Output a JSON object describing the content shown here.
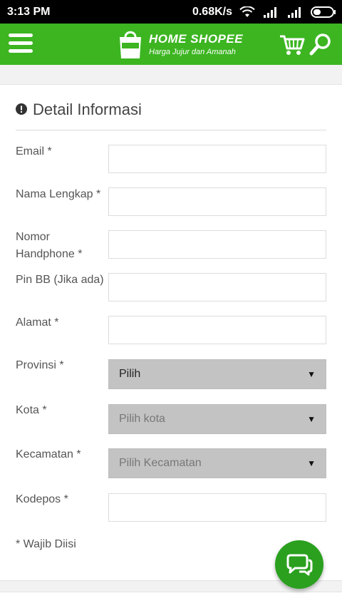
{
  "status_bar": {
    "time": "3:13 PM",
    "speed": "0.68K/s"
  },
  "header": {
    "brand": "HOME SHOPEE",
    "tagline": "Harga Jujur dan Amanah",
    "bag_text": "HOME"
  },
  "form": {
    "title": "Detail Informasi",
    "email_label": "Email *",
    "name_label": "Nama Lengkap *",
    "phone_label": "Nomor Handphone *",
    "pinbb_label": "Pin BB (Jika ada)",
    "address_label": "Alamat *",
    "province_label": "Provinsi *",
    "province_value": "Pilih",
    "city_label": "Kota *",
    "city_value": "Pilih kota",
    "district_label": "Kecamatan *",
    "district_value": "Pilih Kecamatan",
    "postcode_label": "Kodepos *",
    "required_note": "* Wajib Diisi"
  },
  "colors": {
    "brand_green": "#3cb521",
    "fab_green": "#2aa01e",
    "select_gray": "#c3c3c3"
  },
  "icons": {
    "menu": "hamburger-menu-icon",
    "cart": "cart-icon",
    "search": "search-icon",
    "info": "info-icon",
    "chat": "chat-icon"
  }
}
